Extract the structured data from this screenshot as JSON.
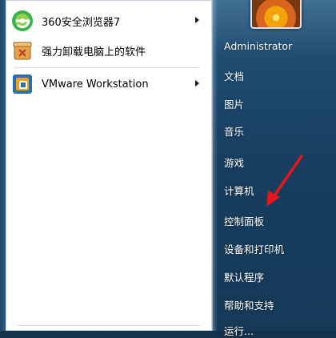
{
  "programs": [
    {
      "label": "360安全浏览器7",
      "icon": "360-browser-icon",
      "has_submenu": true
    },
    {
      "label": "强力卸载电脑上的软件",
      "icon": "uninstall-box-icon",
      "has_submenu": false
    },
    {
      "label": "VMware Workstation",
      "icon": "vmware-icon",
      "has_submenu": true
    }
  ],
  "right_menu": {
    "user": "Administrator",
    "items": [
      "文档",
      "图片",
      "音乐",
      "游戏",
      "计算机",
      "控制面板",
      "设备和打印机",
      "默认程序",
      "帮助和支持",
      "运行..."
    ]
  },
  "colors": {
    "accent_arrow": "#e8151b",
    "left_pane_bg": "#ffffff",
    "right_pane_bg": "#1f4c70"
  }
}
